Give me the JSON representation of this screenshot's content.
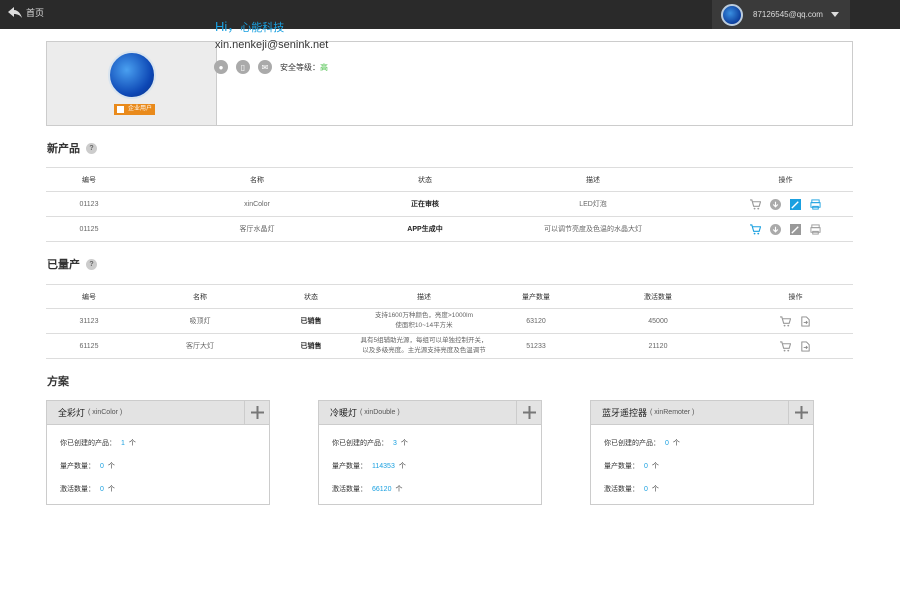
{
  "topbar": {
    "home_label": "首页",
    "account_email": "87126545@qq.com"
  },
  "profile": {
    "badge": "企业用户",
    "greeting": "Hi，",
    "company": "心能科技",
    "email": "xin.nenkeji@senink.net",
    "security_label": "安全等级：",
    "security_level": "高"
  },
  "new_products": {
    "title": "新产品",
    "help": "?",
    "headers": [
      "编号",
      "名称",
      "状态",
      "描述",
      "操作"
    ],
    "rows": [
      {
        "id": "01123",
        "name": "xinColor",
        "status": "正在审核",
        "desc": "LED灯泡"
      },
      {
        "id": "01125",
        "name": "客厅水晶灯",
        "status": "APP生成中",
        "desc": "可以调节亮度及色温的水晶大灯"
      }
    ]
  },
  "mass_products": {
    "title": "已量产",
    "help": "?",
    "headers": [
      "编号",
      "名称",
      "状态",
      "描述",
      "量产数量",
      "激活数量",
      "操作"
    ],
    "rows": [
      {
        "id": "31123",
        "name": "吸顶灯",
        "status": "已销售",
        "desc1": "支持1600万种颜色，亮度>1000lm",
        "desc2": "使面积10~14平方米",
        "mass": "63120",
        "active": "45000"
      },
      {
        "id": "61125",
        "name": "客厅大灯",
        "status": "已销售",
        "desc1": "具有5组辅助光源，每组可以单独控制开关，",
        "desc2": "以及多级亮度。主光源支持亮度及色温调节",
        "mass": "51233",
        "active": "21120"
      }
    ]
  },
  "plans": {
    "title": "方案",
    "created_label": "你已创建的产品：",
    "mass_label": "量产数量：",
    "active_label": "激活数量：",
    "unit": "个",
    "cards": [
      {
        "name": "全彩灯",
        "code": "( xinColor )",
        "created": "1",
        "mass": "0",
        "active": "0"
      },
      {
        "name": "冷暖灯",
        "code": "( xinDouble )",
        "created": "3",
        "mass": "114353",
        "active": "66120"
      },
      {
        "name": "蓝牙遥控器",
        "code": "( xinRemoter )",
        "created": "0",
        "mass": "0",
        "active": "0"
      }
    ]
  }
}
